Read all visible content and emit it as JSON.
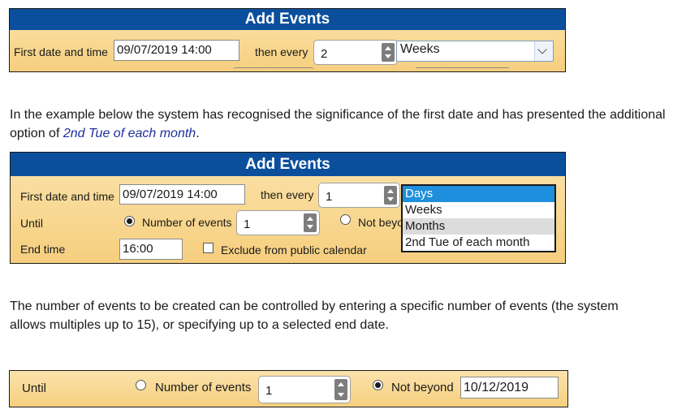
{
  "panel1": {
    "title": "Add Events",
    "first_label": "First date and time",
    "first_value": "09/07/2019 14:00",
    "every_label": "then every",
    "every_value": "2",
    "unit_value": "Weeks"
  },
  "paragraph1": {
    "text_before": "In the example below the system has recognised the significance of the first date and has presented the additional option of ",
    "highlight": "2nd Tue of each month",
    "text_after": "."
  },
  "panel2": {
    "title": "Add Events",
    "first_label": "First date and time",
    "first_value": "09/07/2019 14:00",
    "every_label": "then every",
    "every_value": "1",
    "until_label": "Until",
    "num_events_label": "Number of events",
    "num_events_value": "1",
    "not_beyond_label": "Not beyo",
    "end_time_label": "End time",
    "end_time_value": "16:00",
    "exclude_label": "Exclude from public calendar",
    "dropdown_options": [
      "Days",
      "Weeks",
      "Months",
      "2nd Tue of each month"
    ]
  },
  "paragraph2": {
    "text": "The number of events to be created can be controlled by entering a specific number of events (the system allows multiples up to 15), or specifying up to a selected end date."
  },
  "panel3": {
    "until_label": "Until",
    "num_events_label": "Number of events",
    "num_events_value": "1",
    "not_beyond_label": "Not beyond",
    "not_beyond_value": "10/12/2019"
  },
  "colors": {
    "title_bar": "#0b4f9c",
    "panel_top": "#fbe3ac",
    "panel_bottom": "#f6cf7e",
    "highlight_text": "#1f2f9f",
    "selected_option": "#1e8fdc"
  }
}
